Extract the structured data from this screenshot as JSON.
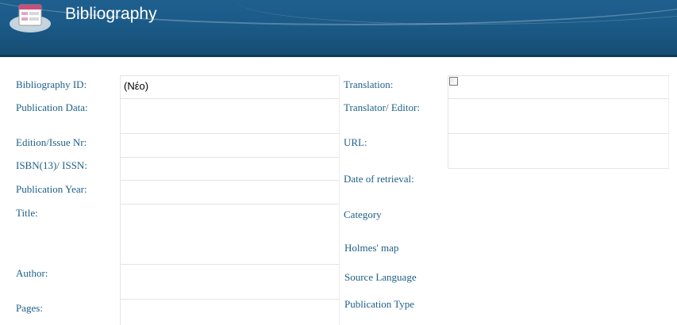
{
  "header": {
    "title": "Bibliography",
    "icon": "form-icon"
  },
  "left_fields": [
    {
      "label": "Bibliography ID:",
      "value": "(Νέο)"
    },
    {
      "label": "Publication Data:",
      "value": ""
    },
    {
      "label": "Edition/Issue Nr:",
      "value": ""
    },
    {
      "label": "ISBN(13)/ ISSN:",
      "value": ""
    },
    {
      "label": "Publication Year:",
      "value": ""
    },
    {
      "label": "Title:",
      "value": ""
    },
    {
      "label": "Author:",
      "value": ""
    },
    {
      "label": "Pages:",
      "value": ""
    }
  ],
  "right_fields": [
    {
      "label": "Translation:",
      "checked": false
    },
    {
      "label": "Translator/ Editor:",
      "value": ""
    },
    {
      "label": "URL:",
      "value": ""
    },
    {
      "label": "Date of retrieval:"
    },
    {
      "label": "Category"
    },
    {
      "label": "Holmes' map"
    },
    {
      "label": "Source Language"
    },
    {
      "label": "Publication Type"
    }
  ]
}
